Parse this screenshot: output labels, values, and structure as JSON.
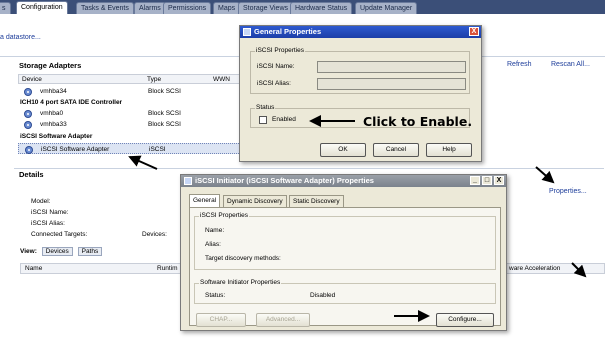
{
  "top_tabs": [
    "Configuration",
    "Tasks & Events",
    "Alarms",
    "Permissions",
    "Maps",
    "Storage Views",
    "Hardware Status",
    "Update Manager"
  ],
  "top_tab_first_partial": "s",
  "datastore_link": "a datastore...",
  "storage_adapters": {
    "title": "Storage Adapters",
    "refresh": "Refresh",
    "rescan": "Rescan All...",
    "columns": [
      "Device",
      "Type",
      "WWN"
    ],
    "rows": [
      {
        "device": "vmhba34",
        "type": "Block SCSI"
      },
      {
        "group": "ICH10 4 port SATA IDE Controller"
      },
      {
        "device": "vmhba0",
        "type": "Block SCSI"
      },
      {
        "device": "vmhba33",
        "type": "Block SCSI"
      },
      {
        "group": "iSCSI Software Adapter"
      },
      {
        "device": "iSCSI Software Adapter",
        "type": "iSCSI"
      }
    ]
  },
  "details": {
    "title": "Details",
    "properties_link": "Properties...",
    "model": "Model:",
    "iscsi_name": "iSCSI Name:",
    "iscsi_alias": "iSCSI Alias:",
    "connected_targets": "Connected Targets:",
    "devices": "Devices:",
    "view_label": "View:",
    "view_devices": "Devices",
    "view_paths": "Paths",
    "grid_cols": [
      "Name",
      "Runtim",
      "ware Acceleration"
    ]
  },
  "general_properties": {
    "title": "General Properties",
    "close": "X",
    "iscsi_properties": "iSCSI Properties",
    "iscsi_name": "iSCSI Name:",
    "iscsi_alias": "iSCSI Alias:",
    "status": "Status",
    "enabled": "Enabled",
    "ok": "OK",
    "cancel": "Cancel",
    "help": "Help"
  },
  "initiator_dialog": {
    "title": "iSCSI Initiator (iSCSI Software Adapter) Properties",
    "min": "_",
    "max": "□",
    "close": "X",
    "tabs": [
      "General",
      "Dynamic Discovery",
      "Static Discovery"
    ],
    "iscsi_properties": "iSCSI Properties",
    "name": "Name:",
    "alias": "Alias:",
    "target_discovery": "Target discovery methods:",
    "software_initiator": "Software Initiator Properties",
    "status_label": "Status:",
    "status_value": "Disabled",
    "chap": "CHAP...",
    "advanced": "Advanced...",
    "configure": "Configure..."
  },
  "annotation": "Click to Enable.",
  "colors": {
    "tabbar": "#3b4f78",
    "link": "#1d3d9a",
    "title_blue": "#2e5ad0",
    "dialog_bg": "#ece9d8"
  }
}
